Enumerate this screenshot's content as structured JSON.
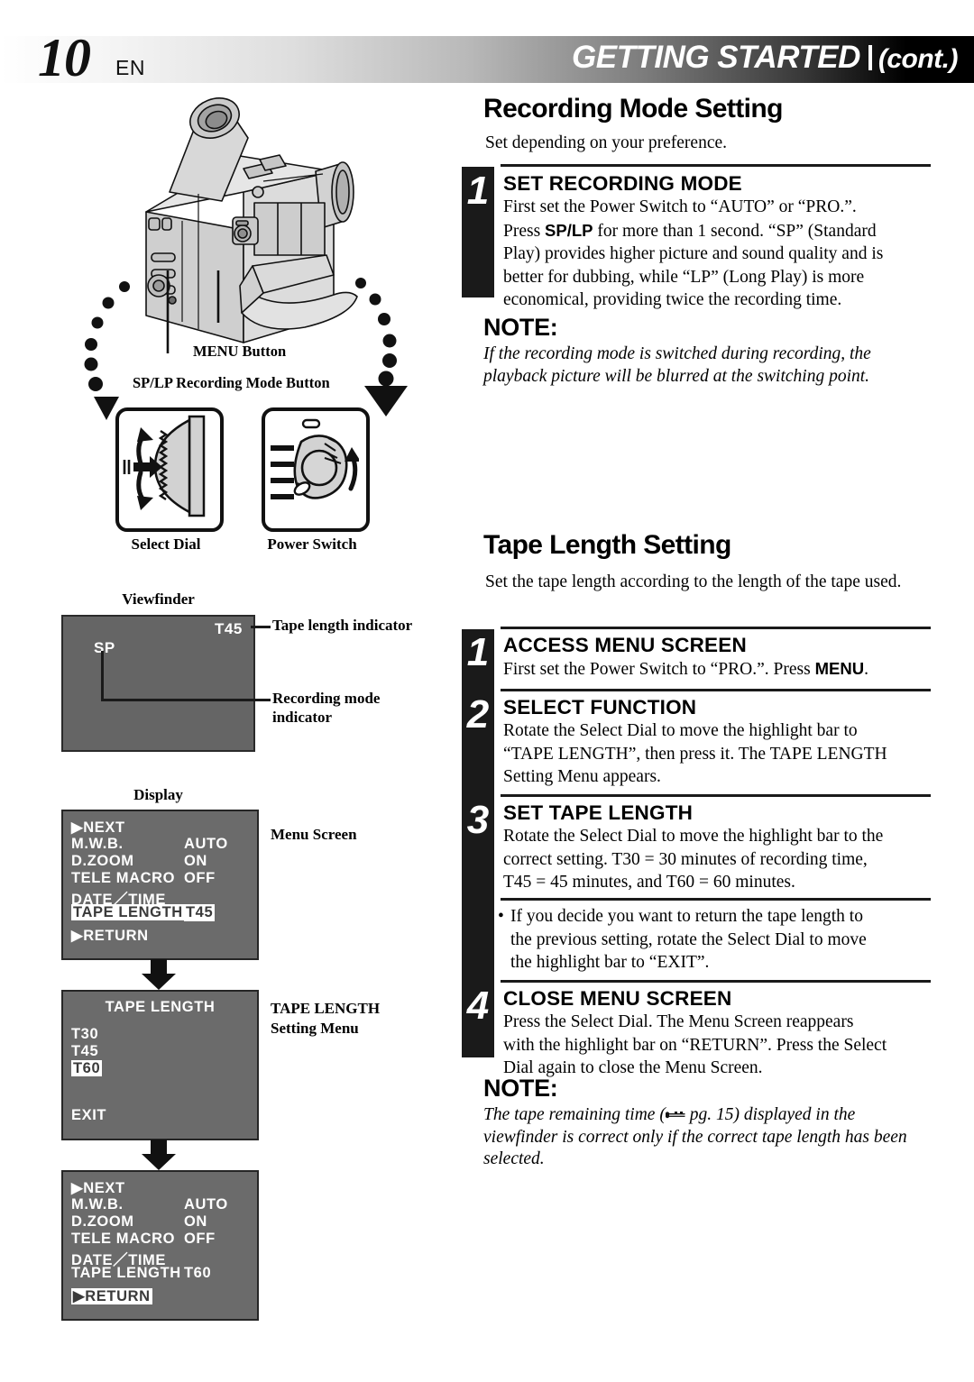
{
  "header": {
    "page_number": "10",
    "lang": "EN",
    "title": "GETTING STARTED",
    "cont": "(cont.)"
  },
  "left": {
    "callouts": {
      "menu_button": "MENU Button",
      "splp_button": "SP/LP Recording Mode Button",
      "select_dial": "Select Dial",
      "power_switch": "Power Switch"
    },
    "viewfinder": {
      "label": "Viewfinder",
      "tape_length_value": "T45",
      "recording_mode_value": "SP",
      "tape_length_caption": "Tape length indicator",
      "recording_mode_caption_l1": "Recording mode",
      "recording_mode_caption_l2": "indicator"
    },
    "display": {
      "label": "Display",
      "menu_screen_caption": "Menu Screen",
      "setting_menu_caption_l1": "TAPE LENGTH",
      "setting_menu_caption_l2": "Setting Menu"
    },
    "menu_screen_1": {
      "rows": [
        {
          "name": "▶NEXT",
          "value": "",
          "highlight": false
        },
        {
          "name": "M.W.B.",
          "value": "AUTO",
          "highlight": false
        },
        {
          "name": "D.ZOOM",
          "value": "ON",
          "highlight": false
        },
        {
          "name": "TELE MACRO",
          "value": "OFF",
          "highlight": false
        },
        {
          "name": "DATE／TIME",
          "value": "",
          "highlight": false
        },
        {
          "name": "TAPE LENGTH",
          "value": "T45",
          "highlight": true
        }
      ],
      "footer": "▶RETURN",
      "footer_highlight": false
    },
    "tape_length_menu": {
      "title": "TAPE LENGTH",
      "options": [
        {
          "label": "T30",
          "selected": false
        },
        {
          "label": "T45",
          "selected": false
        },
        {
          "label": "T60",
          "selected": true
        }
      ],
      "exit": "EXIT"
    },
    "menu_screen_2": {
      "rows": [
        {
          "name": "▶NEXT",
          "value": "",
          "highlight": false
        },
        {
          "name": "M.W.B.",
          "value": "AUTO",
          "highlight": false
        },
        {
          "name": "D.ZOOM",
          "value": "ON",
          "highlight": false
        },
        {
          "name": "TELE MACRO",
          "value": "OFF",
          "highlight": false
        },
        {
          "name": "DATE／TIME",
          "value": "",
          "highlight": false
        },
        {
          "name": "TAPE LENGTH",
          "value": "T60",
          "highlight": false
        }
      ],
      "footer": "▶RETURN",
      "footer_highlight": true
    }
  },
  "right": {
    "section1": {
      "heading": "Recording Mode Setting",
      "lead": "Set depending on your preference.",
      "steps": [
        {
          "num": "1",
          "title": "SET RECORDING MODE",
          "body_html": "First set the Power Switch to “AUTO” or “PRO.”.<br>Press <b>SP/LP</b> for more than 1 second. “SP” (Standard<br>Play) provides higher picture and sound quality and is<br>better for dubbing, while “LP” (Long Play) is more<br>economical, providing twice the recording time."
        }
      ],
      "note": {
        "heading": "NOTE:",
        "body": "If the recording mode is switched during recording, the playback picture will be blurred at the switching point."
      }
    },
    "section2": {
      "heading": "Tape Length Setting",
      "lead": "Set the tape length according to the length of the tape used.",
      "steps": [
        {
          "num": "1",
          "title": "ACCESS MENU SCREEN",
          "body_html": "First set the Power Switch to “PRO.”. Press <b>MENU</b>."
        },
        {
          "num": "2",
          "title": "SELECT FUNCTION",
          "body_html": "Rotate the Select Dial to move the highlight bar to<br>“TAPE LENGTH”, then press it. The TAPE LENGTH<br>Setting Menu appears."
        },
        {
          "num": "3",
          "title": "SET TAPE LENGTH",
          "body_html": "Rotate the Select Dial to move the highlight bar to the<br>correct setting. T30 = 30 minutes of recording time,<br>T45 = 45 minutes, and T60 = 60 minutes."
        },
        {
          "num": "4",
          "title": "CLOSE MENU SCREEN",
          "body_html": "Press the Select Dial. The Menu Screen reappears<br>with the highlight bar on “RETURN”. Press the Select<br>Dial again to close the Menu Screen."
        }
      ],
      "bullet": {
        "marker": "•",
        "body_html": "If you decide you want to return the tape length to<br>the previous setting, rotate the Select Dial to move<br>the highlight bar to “EXIT”."
      },
      "note": {
        "heading": "NOTE:",
        "body_pre": "The tape remaining time (",
        "ref_icon": "pointing-hand-icon",
        "body_ref": " pg. 15",
        "body_post": ") displayed in the viewfinder is correct only if the correct tape length has been selected."
      }
    }
  },
  "colors": {
    "osd_background": "#6b6b6b",
    "viewfinder_background": "#656565",
    "ink": "#1a1a1a",
    "highlight_bg": "#ffffff"
  }
}
